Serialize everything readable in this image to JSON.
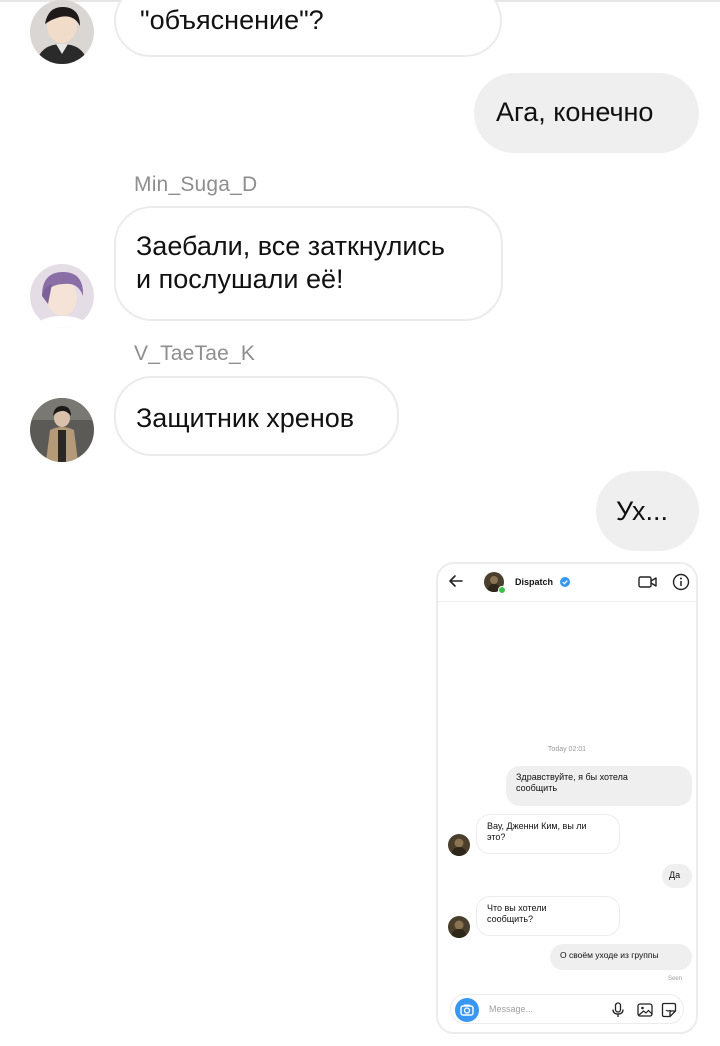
{
  "messages": [
    {
      "id": "m1",
      "direction": "incoming",
      "text": "\"объяснение\"?"
    },
    {
      "id": "m2",
      "direction": "outgoing",
      "text": "Ага, конечно"
    },
    {
      "id": "m3",
      "direction": "incoming",
      "sender": "Min_Suga_D",
      "lines": [
        "Заебали, все заткнулись",
        "и послушали её!"
      ]
    },
    {
      "id": "m4",
      "direction": "incoming",
      "sender": "V_TaeTae_K",
      "text": "Защитник хренов"
    },
    {
      "id": "m5",
      "direction": "outgoing",
      "text": "Ух..."
    }
  ],
  "shared_screenshot": {
    "chat_name": "Dispatch",
    "timestamp": "Today 02:01",
    "messages": [
      {
        "direction": "outgoing",
        "lines": [
          "Здравствуйте, я бы хотела",
          "сообщить"
        ]
      },
      {
        "direction": "incoming",
        "lines": [
          "Вау, Дженни Ким, вы ли",
          "это?"
        ]
      },
      {
        "direction": "outgoing",
        "lines": [
          "Да"
        ]
      },
      {
        "direction": "incoming",
        "lines": [
          "Что вы хотели",
          "сообщить?"
        ]
      },
      {
        "direction": "outgoing",
        "lines": [
          "О своём уходе из группы"
        ]
      }
    ],
    "seen_label": "Seen",
    "input_placeholder": "Message..."
  },
  "icons": {
    "back": "arrow-left-icon",
    "verified": "verified-badge-icon",
    "video": "video-camera-icon",
    "info": "info-icon",
    "camera": "camera-icon",
    "mic": "microphone-icon",
    "gallery": "image-icon",
    "sticker": "sticker-icon"
  },
  "colors": {
    "outgoing_bubble": "#efefef",
    "incoming_border": "#ebebeb",
    "sender_name": "#8e8e8e",
    "accent": "#3897f0",
    "online": "#3ac14a"
  }
}
